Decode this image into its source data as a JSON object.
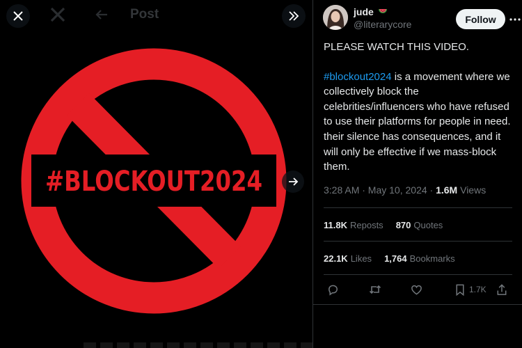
{
  "viewer": {
    "ghost_title": "Post",
    "media_text": "#BLOCKOUT2024",
    "close_icon": "close-icon",
    "expand_icon": "chevrons-right-icon",
    "next_icon": "arrow-right-icon"
  },
  "colors": {
    "sign_red": "#e51e25",
    "accent_blue": "#1d9bf0",
    "muted": "#71767b"
  },
  "post": {
    "author_name": "jude",
    "author_emoji": "watermelon-emoji",
    "handle": "@literarycore",
    "follow_label": "Follow",
    "text_line_1": "PLEASE WATCH THIS VIDEO.",
    "hashtag": "#blockout2024",
    "text_body": " is a movement where we collectively block the celebrities/influencers who have refused to use their platforms for people in need. their silence has consequences, and it will only be effective if we mass-block them.",
    "time": "3:28 AM · May 10, 2024 · ",
    "views_count": "1.6M",
    "views_label": " Views",
    "reposts_count": "11.8K",
    "reposts_label": "Reposts",
    "quotes_count": "870",
    "quotes_label": "Quotes",
    "likes_count": "22.1K",
    "likes_label": "Likes",
    "bookmarks_count": "1,764",
    "bookmarks_label": "Bookmarks",
    "bookmark_action_count": "1.7K"
  }
}
